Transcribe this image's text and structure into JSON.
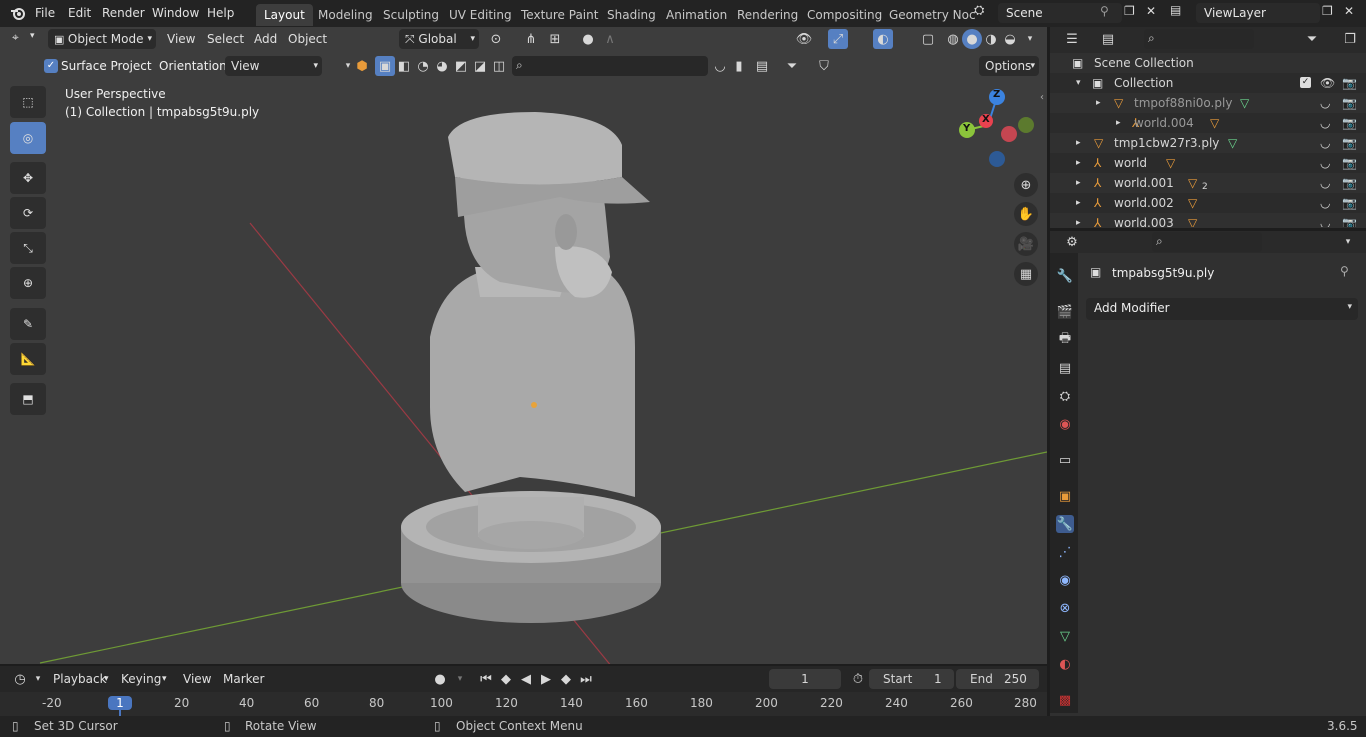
{
  "topbar": {
    "menus": [
      "File",
      "Edit",
      "Render",
      "Window",
      "Help"
    ],
    "workspaces": [
      "Layout",
      "Modeling",
      "Sculpting",
      "UV Editing",
      "Texture Paint",
      "Shading",
      "Animation",
      "Rendering",
      "Compositing",
      "Geometry Noc"
    ],
    "active_workspace": "Layout",
    "scene": "Scene",
    "view_layer": "ViewLayer"
  },
  "viewport_header": {
    "mode": "Object Mode",
    "menus": [
      "View",
      "Select",
      "Add",
      "Object"
    ],
    "transform_orientation": "Global"
  },
  "tool_header": {
    "surface_project_label": "Surface Project",
    "surface_project_checked": true,
    "orientation_label": "Orientation:",
    "orientation_value": "View",
    "options_label": "Options"
  },
  "viewport": {
    "perspective_label": "User Perspective",
    "collection_label": "(1) Collection | tmpabsg5t9u.ply",
    "gizmo_axes": [
      "X",
      "Y",
      "Z"
    ]
  },
  "outliner": {
    "root": "Scene Collection",
    "rows": [
      {
        "name": "Collection",
        "indent": 1
      },
      {
        "name": "tmpof88ni0o.ply",
        "indent": 2
      },
      {
        "name": "world.004",
        "indent": 3
      },
      {
        "name": "tmp1cbw27r3.ply",
        "indent": 1
      },
      {
        "name": "world",
        "indent": 1
      },
      {
        "name": "world.001",
        "indent": 1,
        "badge": "2"
      },
      {
        "name": "world.002",
        "indent": 1
      },
      {
        "name": "world.003",
        "indent": 1
      }
    ]
  },
  "properties": {
    "object_name": "tmpabsg5t9u.ply",
    "add_modifier_label": "Add Modifier"
  },
  "timeline": {
    "menus": [
      "Playback",
      "Keying",
      "View",
      "Marker"
    ],
    "current_frame": "1",
    "start_label": "Start",
    "start_value": "1",
    "end_label": "End",
    "end_value": "250",
    "ruler": [
      "-20",
      "1",
      "20",
      "40",
      "60",
      "80",
      "100",
      "120",
      "140",
      "160",
      "180",
      "200",
      "220",
      "240",
      "260",
      "280"
    ]
  },
  "statusbar": {
    "hint1": "Set 3D Cursor",
    "hint2": "Rotate View",
    "hint3": "Object Context Menu",
    "version": "3.6.5"
  },
  "colors": {
    "accent": "#5680c2",
    "x_axis": "#e8424f",
    "y_axis": "#8bc43b",
    "z_axis": "#3b83e0"
  }
}
